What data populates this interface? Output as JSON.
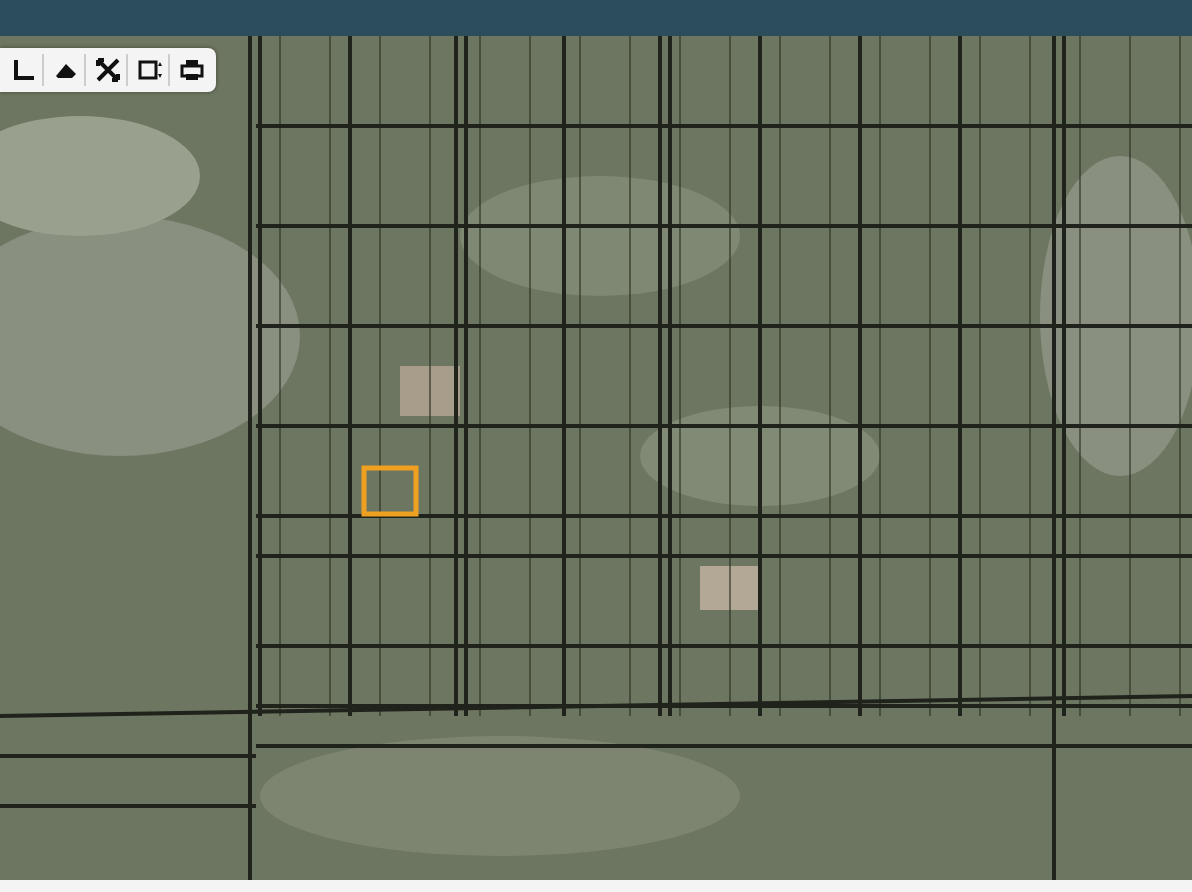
{
  "toolbar": {
    "tools": [
      {
        "kind": "measure"
      },
      {
        "kind": "erase"
      },
      {
        "kind": "fullscreen"
      },
      {
        "kind": "layers"
      },
      {
        "kind": "print"
      }
    ]
  },
  "map": {
    "highlight_parcel": true
  }
}
